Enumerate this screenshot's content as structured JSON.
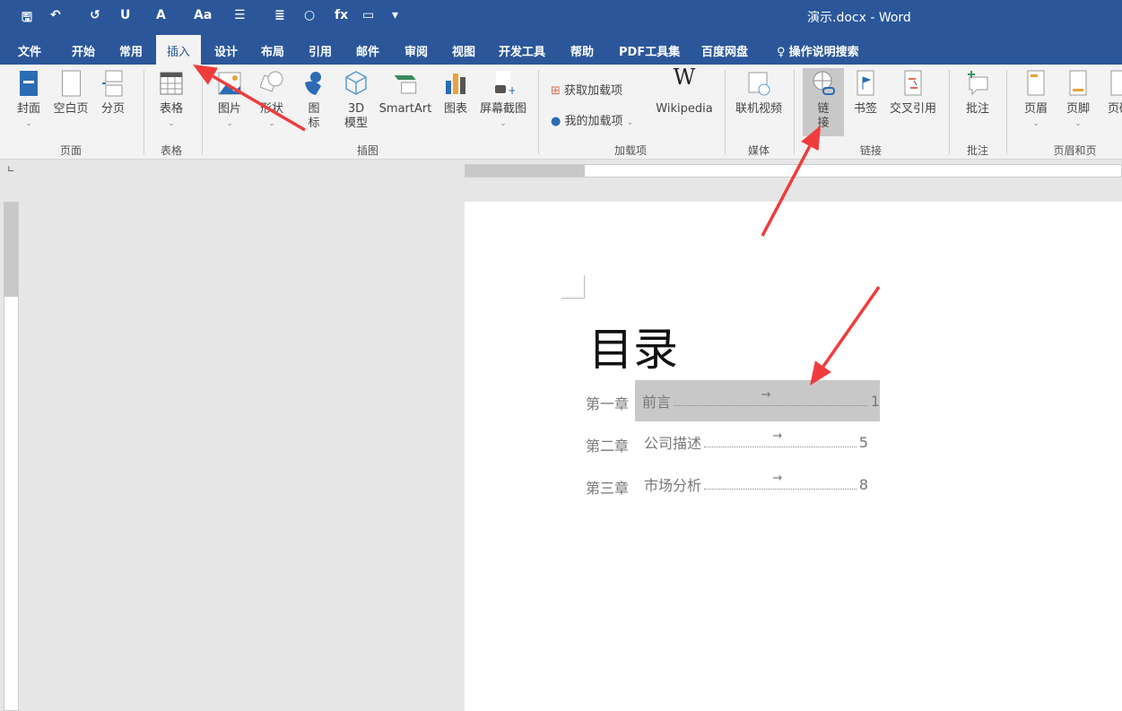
{
  "window": {
    "title": "演示.docx  -  Word"
  },
  "quick_access": [
    {
      "icon": "save-icon",
      "glyph": "🖫"
    },
    {
      "icon": "undo-icon",
      "glyph": "↶"
    },
    {
      "icon": "redo-icon",
      "glyph": "↺"
    },
    {
      "icon": "underline-icon",
      "glyph": "U"
    },
    {
      "icon": "font-color-icon",
      "glyph": "A"
    },
    {
      "icon": "change-case-icon",
      "glyph": "Aa"
    },
    {
      "icon": "bullets-icon",
      "glyph": "☰"
    },
    {
      "icon": "align-icon",
      "glyph": "≣"
    },
    {
      "icon": "shape-circle-icon",
      "glyph": "○"
    },
    {
      "icon": "formula-icon",
      "glyph": "fx"
    },
    {
      "icon": "comment-icon",
      "glyph": "▭"
    },
    {
      "icon": "customize-icon",
      "glyph": "▾"
    }
  ],
  "tabs": [
    "文件",
    "开始",
    "常用",
    "插入",
    "设计",
    "布局",
    "引用",
    "邮件",
    "审阅",
    "视图",
    "开发工具",
    "帮助",
    "PDF工具集",
    "百度网盘"
  ],
  "active_tab": "插入",
  "tell_me": "操作说明搜索",
  "ribbon": {
    "buttons": {
      "cover": "封面",
      "blank": "空白页",
      "break": "分页",
      "table": "表格",
      "picture": "图片",
      "shapes": "形状",
      "icons": "图\n标",
      "model3d": "3D\n模型",
      "smartart": "SmartArt",
      "chart": "图表",
      "screenshot": "屏幕截图",
      "get_addins": "获取加载项",
      "my_addins": "我的加载项",
      "wikipedia": "Wikipedia",
      "online_video": "联机视频",
      "link": "链\n接",
      "bookmark": "书签",
      "crossref": "交叉引用",
      "comment": "批注",
      "header": "页眉",
      "footer": "页脚",
      "pagenum": "页码"
    },
    "groups": {
      "pages": "页面",
      "tables": "表格",
      "illustrations": "插图",
      "addins": "加载项",
      "media": "媒体",
      "links": "链接",
      "comments": "批注",
      "header_footer": "页眉和页脚"
    }
  },
  "document": {
    "title": "目录",
    "toc": [
      {
        "chapter": "第一章",
        "title": "前言",
        "page": "1"
      },
      {
        "chapter": "第二章",
        "title": "公司描述",
        "page": "5"
      },
      {
        "chapter": "第三章",
        "title": "市场分析",
        "page": "8"
      }
    ],
    "arrow_glyph": "→"
  },
  "colors": {
    "brand": "#2b579a",
    "annotation_arrow": "#f03c3c",
    "selection": "#c8c8c8"
  }
}
